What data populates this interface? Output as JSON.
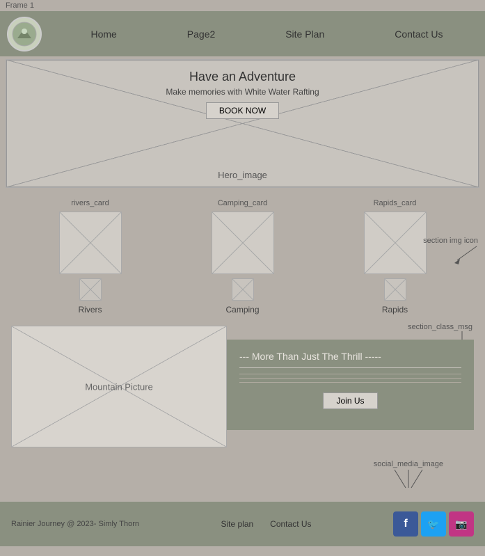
{
  "frame": {
    "label": "Frame 1"
  },
  "navbar": {
    "logo_alt": "Rainier Journey logo",
    "links": [
      {
        "label": "Home",
        "id": "home"
      },
      {
        "label": "Page2",
        "id": "page2"
      },
      {
        "label": "Site Plan",
        "id": "site-plan"
      },
      {
        "label": "Contact Us",
        "id": "contact-us"
      }
    ]
  },
  "hero": {
    "title": "Have an Adventure",
    "subtitle": "Make memories with White Water Rafting",
    "book_button": "BOOK NOW",
    "image_label": "Hero_image"
  },
  "cards": {
    "section_img_icon_label": "section img icon",
    "items": [
      {
        "top_label": "rivers_card",
        "bottom_label": "Rivers"
      },
      {
        "top_label": "Camping_card",
        "bottom_label": "Camping"
      },
      {
        "top_label": "Rapids_card",
        "bottom_label": "Rapids"
      }
    ]
  },
  "middle": {
    "mountain_label": "Mountain Picture",
    "section_class_msg_label": "section_class_msg",
    "info_title": "--- More Than Just The Thrill -----",
    "join_button": "Join Us"
  },
  "footer": {
    "copyright": "Rainier Journey @ 2023- Simly Thorn",
    "site_plan_link": "Site plan",
    "contact_link": "Contact Us",
    "social_media_label": "social_media_image",
    "social": [
      {
        "icon": "f",
        "label": "Facebook",
        "class": "social-fb"
      },
      {
        "icon": "t",
        "label": "Twitter",
        "class": "social-tw"
      },
      {
        "icon": "ig",
        "label": "Instagram",
        "class": "social-ig"
      }
    ]
  }
}
